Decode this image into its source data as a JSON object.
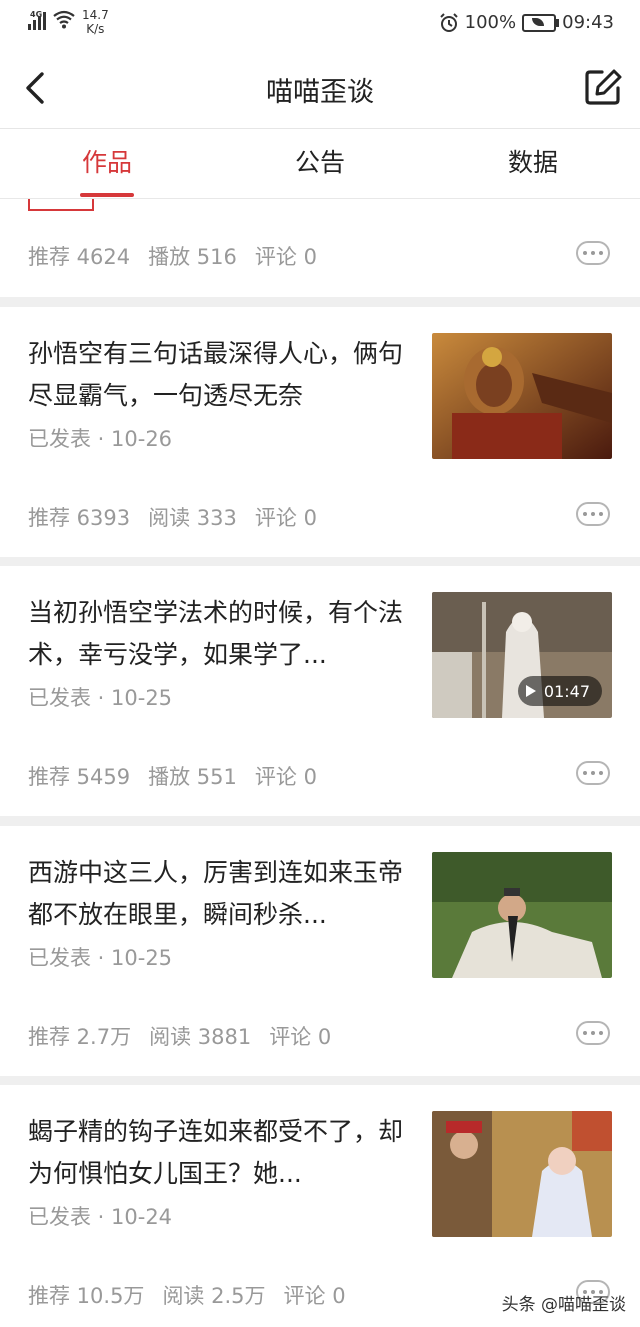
{
  "status": {
    "network": "4G",
    "speed_value": "14.7",
    "speed_unit": "K/s",
    "battery": "100%",
    "time": "09:43"
  },
  "nav": {
    "title": "喵喵歪谈"
  },
  "tabs": [
    {
      "label": "作品"
    },
    {
      "label": "公告"
    },
    {
      "label": "数据"
    }
  ],
  "top_stats": {
    "rec": "推荐 4624",
    "play": "播放 516",
    "comment": "评论 0"
  },
  "articles": [
    {
      "title": "孙悟空有三句话最深得人心，俩句尽显霸气，一句透尽无奈",
      "date": "已发表 · 10-26",
      "rec": "推荐 6393",
      "mid": "阅读 333",
      "comment": "评论 0"
    },
    {
      "title": "当初孙悟空学法术的时候，有个法术，幸亏没学，如果学了...",
      "date": "已发表 · 10-25",
      "rec": "推荐 5459",
      "mid": "播放 551",
      "comment": "评论 0",
      "duration": "01:47"
    },
    {
      "title": "西游中这三人，厉害到连如来玉帝都不放在眼里，瞬间秒杀...",
      "date": "已发表 · 10-25",
      "rec": "推荐 2.7万",
      "mid": "阅读 3881",
      "comment": "评论 0"
    },
    {
      "title": "蝎子精的钩子连如来都受不了，却为何惧怕女儿国王？她...",
      "date": "已发表 · 10-24",
      "rec": "推荐 10.5万",
      "mid": "阅读 2.5万",
      "comment": "评论 0"
    }
  ],
  "watermark": "头条 @喵喵歪谈",
  "colors": {
    "accent": "#d6383a",
    "muted": "#999999"
  }
}
